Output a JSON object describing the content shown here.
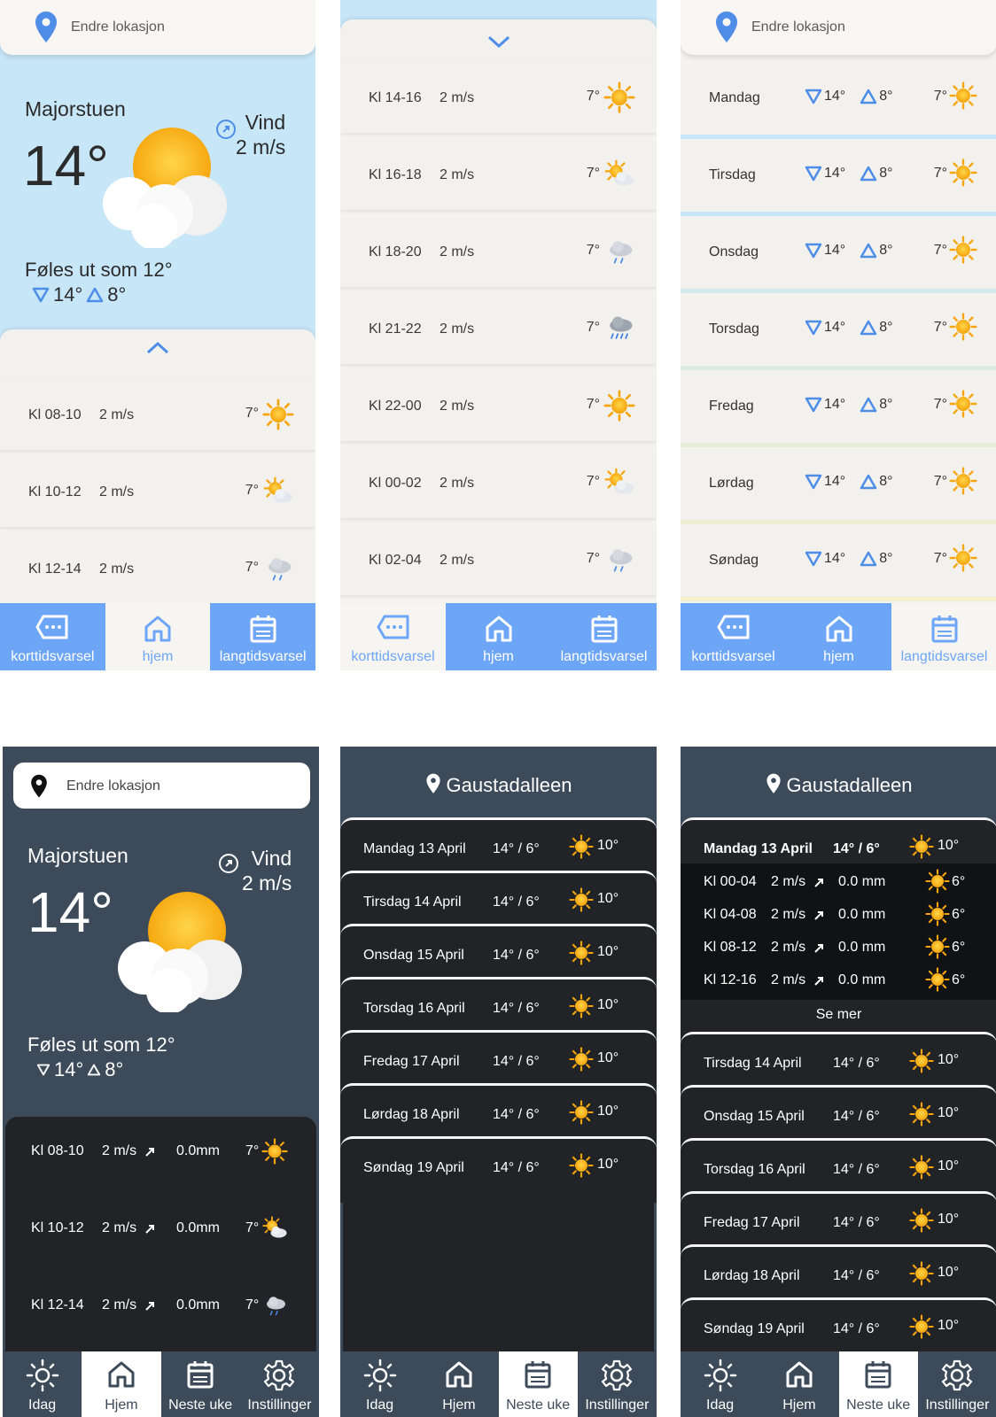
{
  "light": {
    "location_placeholder": "Endre lokasjon",
    "city": "Majorstuen",
    "temp": "14°",
    "wind_label": "Vind",
    "wind_value": "2 m/s",
    "feels_like": "Føles ut som 12°",
    "min_temp": "14°",
    "max_temp": "8°",
    "nav": [
      "korttidsvarsel",
      "hjem",
      "langtidsvarsel"
    ],
    "hours_screen1": [
      {
        "time": "Kl 08-10",
        "wind": "2 m/s",
        "temp": "7°",
        "icon": "sun-icon"
      },
      {
        "time": "Kl 10-12",
        "wind": "2 m/s",
        "temp": "7°",
        "icon": "partly-cloudy-icon"
      },
      {
        "time": "Kl 12-14",
        "wind": "2 m/s",
        "temp": "7°",
        "icon": "cloud-drizzle-icon"
      }
    ],
    "hours_screen2": [
      {
        "time": "Kl 14-16",
        "wind": "2 m/s",
        "temp": "7°",
        "icon": "sun-icon"
      },
      {
        "time": "Kl 16-18",
        "wind": "2 m/s",
        "temp": "7°",
        "icon": "partly-cloudy-icon"
      },
      {
        "time": "Kl 18-20",
        "wind": "2 m/s",
        "temp": "7°",
        "icon": "cloud-drizzle-icon"
      },
      {
        "time": "Kl 21-22",
        "wind": "2 m/s",
        "temp": "7°",
        "icon": "rain-cloud-icon"
      },
      {
        "time": "Kl 22-00",
        "wind": "2 m/s",
        "temp": "7°",
        "icon": "sun-icon"
      },
      {
        "time": "Kl 00-02",
        "wind": "2 m/s",
        "temp": "7°",
        "icon": "partly-cloudy-icon"
      },
      {
        "time": "Kl 02-04",
        "wind": "2 m/s",
        "temp": "7°",
        "icon": "cloud-drizzle-icon"
      }
    ],
    "days": [
      {
        "day": "Mandag",
        "min": "14°",
        "max": "8°",
        "temp": "7°"
      },
      {
        "day": "Tirsdag",
        "min": "14°",
        "max": "8°",
        "temp": "7°"
      },
      {
        "day": "Onsdag",
        "min": "14°",
        "max": "8°",
        "temp": "7°"
      },
      {
        "day": "Torsdag",
        "min": "14°",
        "max": "8°",
        "temp": "7°"
      },
      {
        "day": "Fredag",
        "min": "14°",
        "max": "8°",
        "temp": "7°"
      },
      {
        "day": "Lørdag",
        "min": "14°",
        "max": "8°",
        "temp": "7°"
      },
      {
        "day": "Søndag",
        "min": "14°",
        "max": "8°",
        "temp": "7°"
      }
    ]
  },
  "dark": {
    "location_placeholder": "Endre lokasjon",
    "city": "Majorstuen",
    "temp": "14°",
    "wind_label": "Vind",
    "wind_value": "2 m/s",
    "feels_like": "Føles ut som 12°",
    "min_temp": "14°",
    "max_temp": "8°",
    "hours": [
      {
        "time": "Kl 08-10",
        "wind": "2 m/s",
        "rain": "0.0mm",
        "temp": "7°",
        "icon": "sun-icon"
      },
      {
        "time": "Kl 10-12",
        "wind": "2 m/s",
        "rain": "0.0mm",
        "temp": "7°",
        "icon": "partly-cloudy-icon"
      },
      {
        "time": "Kl 12-14",
        "wind": "2 m/s",
        "rain": "0.0mm",
        "temp": "7°",
        "icon": "cloud-drizzle-icon"
      }
    ],
    "nav": [
      "Idag",
      "Hjem",
      "Neste uke",
      "Instillinger"
    ],
    "week_location": "Gaustadalleen",
    "week": [
      {
        "day": "Mandag 13 April",
        "temps": "14°  /  6°",
        "high": "10°"
      },
      {
        "day": "Tirsdag 14 April",
        "temps": "14°  /  6°",
        "high": "10°"
      },
      {
        "day": "Onsdag 15 April",
        "temps": "14°  /  6°",
        "high": "10°"
      },
      {
        "day": "Torsdag 16 April",
        "temps": "14°  /  6°",
        "high": "10°"
      },
      {
        "day": "Fredag   17 April",
        "temps": "14°  /  6°",
        "high": "10°"
      },
      {
        "day": "Lørdag  18 April",
        "temps": "14°  / 6°",
        "high": "10°"
      },
      {
        "day": "Søndag 19 April",
        "temps": "14°  / 6°",
        "high": "10°"
      }
    ],
    "detail_hours": [
      {
        "time": "Kl 00-04",
        "wind": "2 m/s",
        "rain": "0.0 mm",
        "temp": "6°"
      },
      {
        "time": "Kl 04-08",
        "wind": "2 m/s",
        "rain": "0.0 mm",
        "temp": "6°"
      },
      {
        "time": "Kl 08-12",
        "wind": "2 m/s",
        "rain": "0.0 mm",
        "temp": "6°"
      },
      {
        "time": "Kl 12-16",
        "wind": "2 m/s",
        "rain": "0.0 mm",
        "temp": "6°"
      }
    ],
    "see_more": "Se mer"
  },
  "colors": {
    "accent_blue": "#6ea6f7",
    "sky": "#c7e6f8",
    "dark_bg": "#3d4a5a",
    "dark_sheet": "#222326",
    "sun": "#f5b41a"
  }
}
